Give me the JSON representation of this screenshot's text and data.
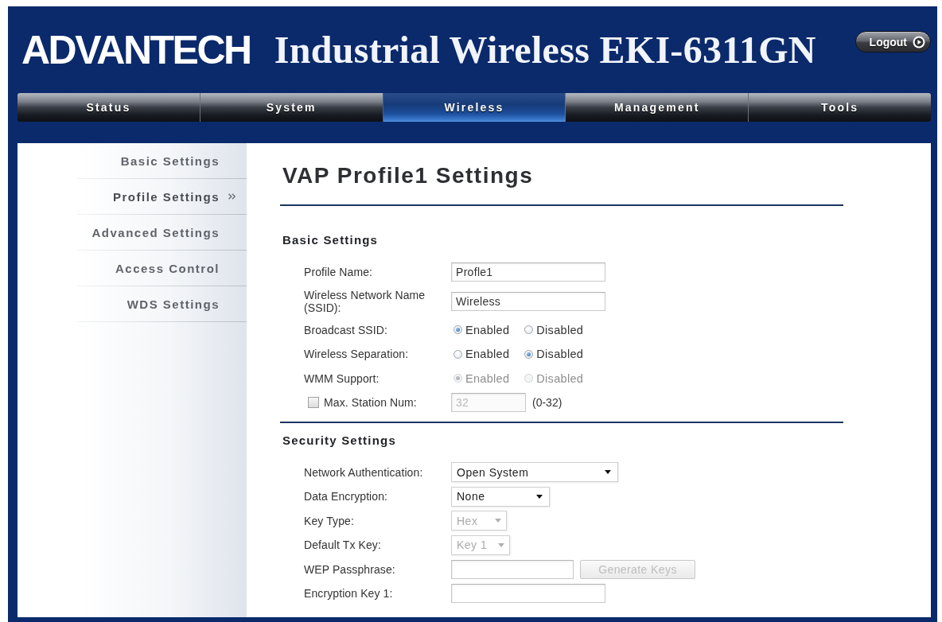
{
  "header": {
    "logo": "ADVANTECH",
    "title": "Industrial Wireless EKI-6311GN",
    "logout": "Logout"
  },
  "tabs": [
    {
      "label": "Status",
      "selected": false
    },
    {
      "label": "System",
      "selected": false
    },
    {
      "label": "Wireless",
      "selected": true
    },
    {
      "label": "Management",
      "selected": false
    },
    {
      "label": "Tools",
      "selected": false
    }
  ],
  "sidebar": {
    "items": [
      {
        "label": "Basic Settings",
        "selected": false
      },
      {
        "label": "Profile Settings",
        "selected": true
      },
      {
        "label": "Advanced Settings",
        "selected": false
      },
      {
        "label": "Access Control",
        "selected": false
      },
      {
        "label": "WDS Settings",
        "selected": false
      }
    ]
  },
  "page_title": "VAP Profile1 Settings",
  "sections": [
    {
      "heading": "Basic Settings",
      "rows": [
        {
          "kind": "text",
          "label": "Profile Name:",
          "value": "Profle1"
        },
        {
          "kind": "text",
          "label": "Wireless Network Name (SSID):",
          "value": "Wireless"
        },
        {
          "kind": "radio",
          "label": "Broadcast SSID:",
          "options": [
            {
              "label": "Enabled",
              "selected": true,
              "disabled": false
            },
            {
              "label": "Disabled",
              "selected": false,
              "disabled": false
            }
          ]
        },
        {
          "kind": "radio",
          "label": "Wireless Separation:",
          "options": [
            {
              "label": "Enabled",
              "selected": false,
              "disabled": false
            },
            {
              "label": "Disabled",
              "selected": true,
              "disabled": false
            }
          ]
        },
        {
          "kind": "radio",
          "label": "WMM Support:",
          "options": [
            {
              "label": "Enabled",
              "selected": true,
              "disabled": true
            },
            {
              "label": "Disabled",
              "selected": false,
              "disabled": true
            }
          ]
        },
        {
          "kind": "check_text",
          "label": "Max. Station Num:",
          "checked": false,
          "value": "32",
          "disabled": true,
          "hint": "(0-32)"
        }
      ]
    },
    {
      "heading": "Security Settings",
      "rows": [
        {
          "kind": "select",
          "label": "Network Authentication:",
          "value": "Open System",
          "disabled": false
        },
        {
          "kind": "select",
          "label": "Data Encryption:",
          "value": "None",
          "disabled": false
        },
        {
          "kind": "select",
          "label": "Key Type:",
          "value": "Hex",
          "disabled": true
        },
        {
          "kind": "select",
          "label": "Default Tx Key:",
          "value": "Key 1",
          "disabled": true
        },
        {
          "kind": "text_button",
          "label": "WEP Passphrase:",
          "button": "Generate Keys",
          "button_disabled": true
        },
        {
          "kind": "text",
          "label": "Encryption Key 1:"
        }
      ]
    }
  ]
}
